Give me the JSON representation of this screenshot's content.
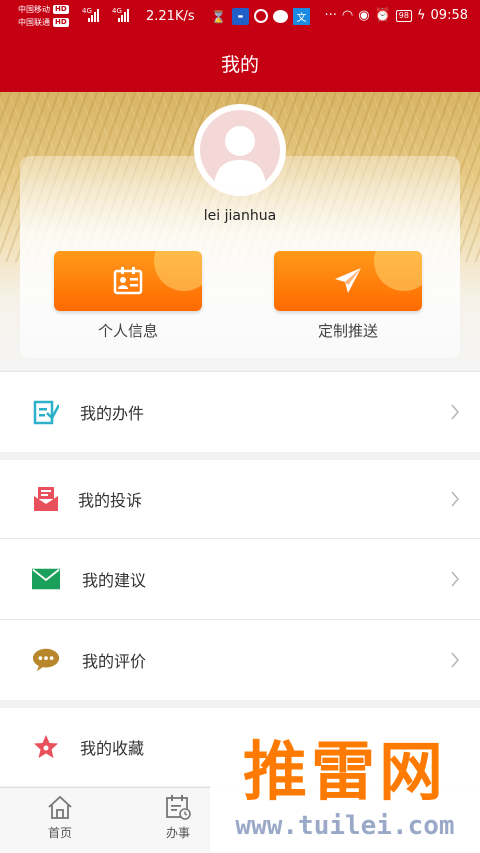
{
  "status_bar": {
    "carrier1": "中国移动",
    "carrier2": "中国联通",
    "hd_badge": "HD",
    "net1": "4G",
    "net2": "4G",
    "speed": "2.21K/s",
    "icons": [
      "hourglass-icon",
      "app-icon",
      "browser-icon",
      "chat-icon",
      "translate-icon",
      "more-icon",
      "headset-icon",
      "eye-icon",
      "alarm-icon"
    ],
    "battery": "98",
    "time": "09:58"
  },
  "header": {
    "title": "我的"
  },
  "profile": {
    "username": "lei jianhua"
  },
  "actions": [
    {
      "label": "个人信息",
      "icon": "id-card-icon"
    },
    {
      "label": "定制推送",
      "icon": "paper-plane-icon"
    }
  ],
  "menu": [
    {
      "label": "我的办件",
      "icon": "edit-document-icon",
      "color": "#2db0c9"
    },
    {
      "label": "我的投诉",
      "icon": "envelope-open-icon",
      "color": "#e8505b"
    },
    {
      "label": "我的建议",
      "icon": "envelope-icon",
      "color": "#1aa05a"
    },
    {
      "label": "我的评价",
      "icon": "speech-bubble-icon",
      "color": "#b8862b"
    },
    {
      "label": "我的收藏",
      "icon": "star-icon",
      "color": "#e8505b"
    }
  ],
  "tabs": [
    {
      "label": "首页",
      "icon": "home-icon"
    },
    {
      "label": "办事",
      "icon": "calendar-icon"
    }
  ],
  "watermark": {
    "text": "推雷网",
    "url": "www.tuilei.com"
  },
  "colors": {
    "brand_red": "#c40012",
    "button_orange": "#ff7a00"
  }
}
